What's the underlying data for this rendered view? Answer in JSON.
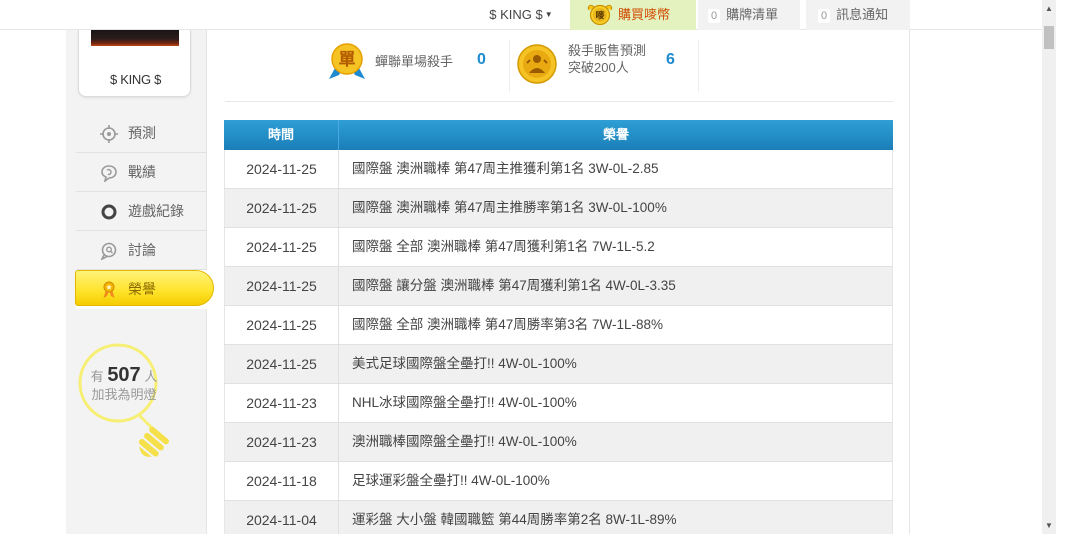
{
  "topbar": {
    "user_label": "$ KING $",
    "buy_label": "購買嘜幣",
    "coin_text": "嘜",
    "cart_count": "0",
    "cart_label": "購牌清單",
    "notice_count": "0",
    "notice_label": "訊息通知"
  },
  "sidebar": {
    "username": "$ KING $",
    "menu": [
      {
        "label": "預測",
        "icon": "target-icon"
      },
      {
        "label": "戰績",
        "icon": "chat-icon"
      },
      {
        "label": "遊戲紀錄",
        "icon": "circle-icon"
      },
      {
        "label": "討論",
        "icon": "search-chat-icon"
      },
      {
        "label": "榮譽",
        "icon": "medal-icon"
      }
    ],
    "fans": {
      "prefix": "有",
      "count": "507",
      "suffix": "人",
      "line2": "加我為明燈"
    }
  },
  "stats": {
    "stat1": {
      "badge": "單",
      "label": "蟬聯單場殺手",
      "value": "0"
    },
    "stat2": {
      "label_line1": "殺手販售預測",
      "label_line2": "突破200人",
      "value": "6"
    }
  },
  "table": {
    "headers": [
      "時間",
      "榮譽"
    ],
    "rows": [
      {
        "date": "2024-11-25",
        "honor": "國際盤 澳洲職棒 第47周主推獲利第1名 3W-0L-2.85"
      },
      {
        "date": "2024-11-25",
        "honor": "國際盤 澳洲職棒 第47周主推勝率第1名 3W-0L-100%"
      },
      {
        "date": "2024-11-25",
        "honor": "國際盤 全部 澳洲職棒 第47周獲利第1名 7W-1L-5.2"
      },
      {
        "date": "2024-11-25",
        "honor": "國際盤 讓分盤 澳洲職棒 第47周獲利第1名 4W-0L-3.35"
      },
      {
        "date": "2024-11-25",
        "honor": "國際盤 全部 澳洲職棒 第47周勝率第3名 7W-1L-88%"
      },
      {
        "date": "2024-11-25",
        "honor": "美式足球國際盤全壘打!! 4W-0L-100%"
      },
      {
        "date": "2024-11-23",
        "honor": "NHL冰球國際盤全壘打!! 4W-0L-100%"
      },
      {
        "date": "2024-11-23",
        "honor": "澳洲職棒國際盤全壘打!! 4W-0L-100%"
      },
      {
        "date": "2024-11-18",
        "honor": "足球運彩盤全壘打!! 4W-0L-100%"
      },
      {
        "date": "2024-11-04",
        "honor": "運彩盤 大小盤 韓國職籃 第44周勝率第2名 8W-1L-89%"
      }
    ]
  },
  "colors": {
    "accent": "#1e8bd0",
    "header": "#1b7eb8",
    "active": "#ffe32a",
    "buy": "#d04a00"
  }
}
